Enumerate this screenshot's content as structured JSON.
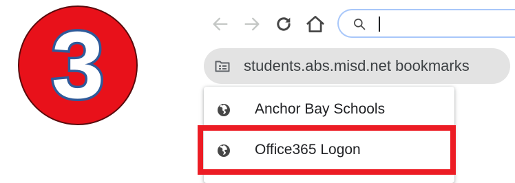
{
  "step": {
    "number": "3",
    "badge_color": "#e8111a",
    "digit_color": "#2f5b9a"
  },
  "toolbar": {
    "back_icon": "arrow-left-icon",
    "forward_icon": "arrow-right-icon",
    "reload_icon": "reload-icon",
    "home_icon": "home-icon",
    "search_icon": "search-icon",
    "omnibox_value": ""
  },
  "bookmarks_bar": {
    "folder_icon": "bookmark-folder-icon",
    "folder_label": "students.abs.misd.net bookmarks"
  },
  "dropdown": {
    "items": [
      {
        "label": "Anchor Bay Schools",
        "icon": "globe-icon"
      },
      {
        "label": "Office365 Logon",
        "icon": "globe-icon",
        "highlighted": true
      }
    ]
  },
  "highlight": {
    "color": "#ec1c24"
  }
}
